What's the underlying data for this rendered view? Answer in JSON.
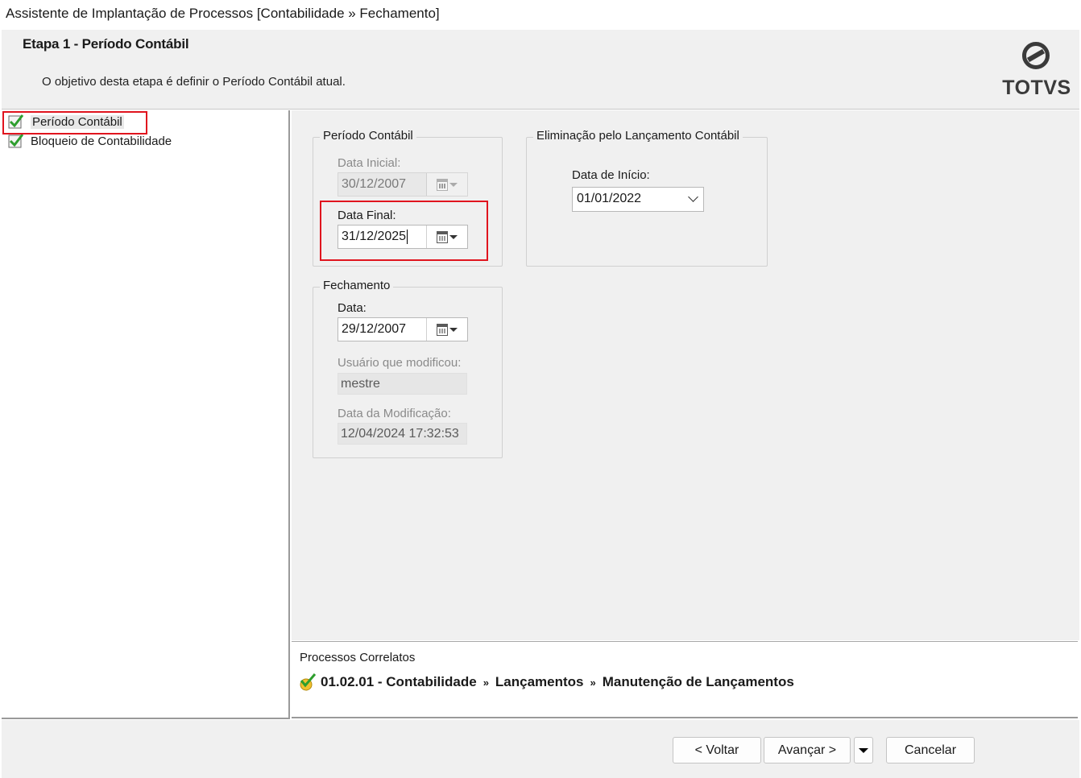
{
  "window": {
    "title": "Assistente de Implantação de Processos [Contabilidade » Fechamento]"
  },
  "header": {
    "step_title": "Etapa 1 - Período Contábil",
    "description": "O objetivo desta etapa é definir o Período Contábil atual.",
    "logo_text": "TOTVS"
  },
  "tree": {
    "items": [
      {
        "label": "Período Contábil",
        "selected": true,
        "checked": true
      },
      {
        "label": "Bloqueio de Contabilidade",
        "selected": false,
        "checked": true
      }
    ]
  },
  "periodo": {
    "legend": "Período Contábil",
    "data_inicial_label": "Data Inicial:",
    "data_inicial_value": "30/12/2007",
    "data_final_label": "Data Final:",
    "data_final_value": "31/12/2025"
  },
  "eliminacao": {
    "legend": "Eliminação pelo Lançamento Contábil",
    "data_inicio_label": "Data de Início:",
    "data_inicio_value": "01/01/2022"
  },
  "fechamento": {
    "legend": "Fechamento",
    "data_label": "Data:",
    "data_value": "29/12/2007",
    "usuario_label": "Usuário que modificou:",
    "usuario_value": "mestre",
    "data_mod_label": "Data da Modificação:",
    "data_mod_value": "12/04/2024 17:32:53"
  },
  "related": {
    "title": "Processos Correlatos",
    "path": [
      "01.02.01 - Contabilidade",
      "Lançamentos",
      "Manutenção de Lançamentos"
    ],
    "separator": "»"
  },
  "footer": {
    "back_label": "< Voltar",
    "next_label": "Avançar >",
    "cancel_label": "Cancelar"
  },
  "colors": {
    "highlight_border": "#e0141e",
    "check_green": "#2e9e2e"
  }
}
